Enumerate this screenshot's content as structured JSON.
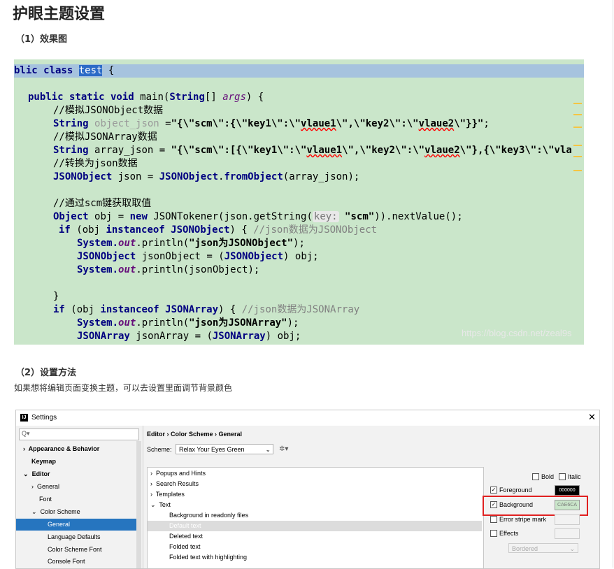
{
  "article": {
    "title": "护眼主题设置",
    "section1": "（1）效果图",
    "section2": "（2）设置方法",
    "paragraph": "如果想将编辑页面变换主题，可以去设置里面调节背景颜色"
  },
  "code": {
    "line1_a": "blic class ",
    "line1_sel": "test",
    "line1_b": " {",
    "l2_kw": "public static void ",
    "l2_rest": "main(",
    "l2_type": "String",
    "l2_rest2": "[] ",
    "l2_args": "args",
    "l2_end": ") {",
    "c1": "//模拟JSONObject数据",
    "l4_type": "String ",
    "l4_var": "object_json",
    "l4_eq": " =",
    "l4_s1": "\"{\\\"scm\\\":{\\\"key1\\\":\\\"",
    "l4_w1": "vlaue1",
    "l4_s2": "\\\",\\\"key2\\\":\\\"",
    "l4_w2": "vlaue2",
    "l4_s3": "\\\"}}\"",
    "l4_end": ";",
    "c2": "//模拟JSONArray数据",
    "l6_type": "String ",
    "l6_var": "array_json",
    "l6_eq": " = ",
    "l6_s1": "\"{\\\"scm\\\":[{\\\"key1\\\":\\\"",
    "l6_w1": "vlaue1",
    "l6_s2": "\\\",\\\"key2\\\":\\\"",
    "l6_w2": "vlaue2",
    "l6_s3": "\\\"},{\\\"key3\\\":\\\"",
    "l6_w3": "vla",
    "c3": "//转换为json数据",
    "l8_type": "JSONObject ",
    "l8_rest": "json = ",
    "l8_cls": "JSONObject",
    "l8_dot": ".",
    "l8_m": "fromObject",
    "l8_end": "(array_json);",
    "c4": "//通过scm键获取取值",
    "l10_type": "Object ",
    "l10_a": "obj = ",
    "l10_new": "new ",
    "l10_b": "JSONTokener(json.getString(",
    "l10_hint": "key:",
    "l10_str": " \"scm\"",
    "l10_c": ")).nextValue();",
    "l11_if": "if ",
    "l11_a": "(obj ",
    "l11_inst": "instanceof ",
    "l11_cls": "JSONObject",
    "l11_b": ") { ",
    "l11_cm": "//json数据为JSONObject",
    "l12_sys": "System.",
    "l12_out": "out",
    "l12_a": ".println(",
    "l12_str": "\"json为JSONObject\"",
    "l12_b": ");",
    "l13_type": "JSONObject ",
    "l13_a": "jsonObject = (",
    "l13_cls": "JSONObject",
    "l13_b": ") obj;",
    "l14_sys": "System.",
    "l14_out": "out",
    "l14_a": ".println(jsonObject);",
    "l16": "}",
    "l17_if": "if ",
    "l17_a": "(obj ",
    "l17_inst": "instanceof ",
    "l17_cls": "JSONArray",
    "l17_b": ") { ",
    "l17_cm": "//json数据为JSONArray",
    "l18_sys": "System.",
    "l18_out": "out",
    "l18_a": ".println(",
    "l18_str": "\"json为JSONArray\"",
    "l18_b": ");",
    "l19_type": "JSONArray ",
    "l19_a": "jsonArray = (",
    "l19_cls": "JSONArray",
    "l19_b": ") obj;",
    "watermark": "https://blog.csdn.net/zeal9s"
  },
  "settings": {
    "window_title": "Settings",
    "search_placeholder": "Q▾",
    "sidebar": [
      {
        "label": "Appearance & Behavior",
        "arrow": "›"
      },
      {
        "label": "Keymap",
        "arrow": ""
      },
      {
        "label": "Editor",
        "arrow": "⌄"
      },
      {
        "label": "General",
        "arrow": "›"
      },
      {
        "label": "Font",
        "arrow": ""
      },
      {
        "label": "Color Scheme",
        "arrow": "⌄"
      },
      {
        "label": "General",
        "arrow": ""
      },
      {
        "label": "Language Defaults",
        "arrow": ""
      },
      {
        "label": "Color Scheme Font",
        "arrow": ""
      },
      {
        "label": "Console Font",
        "arrow": ""
      }
    ],
    "breadcrumb": "Editor  ›  Color Scheme  ›  General",
    "scheme_label": "Scheme:",
    "scheme_value": "Relax Your Eyes Green",
    "tree": [
      "Popups and Hints",
      "Search Results",
      "Templates",
      "Text",
      "Background in readonly files",
      "Default text",
      "Deleted text",
      "Folded text",
      "Folded text with highlighting"
    ],
    "bold_label": "Bold",
    "italic_label": "Italic",
    "foreground_label": "Foreground",
    "foreground_value": "000000",
    "background_label": "Background",
    "background_value": "CAE6CA",
    "error_stripe_label": "Error stripe mark",
    "effects_label": "Effects",
    "effects_value": "Bordered",
    "colors": {
      "code_bg": "#CAE6CA",
      "selection": "#2675BF",
      "highlight_box": "#E02020"
    }
  }
}
